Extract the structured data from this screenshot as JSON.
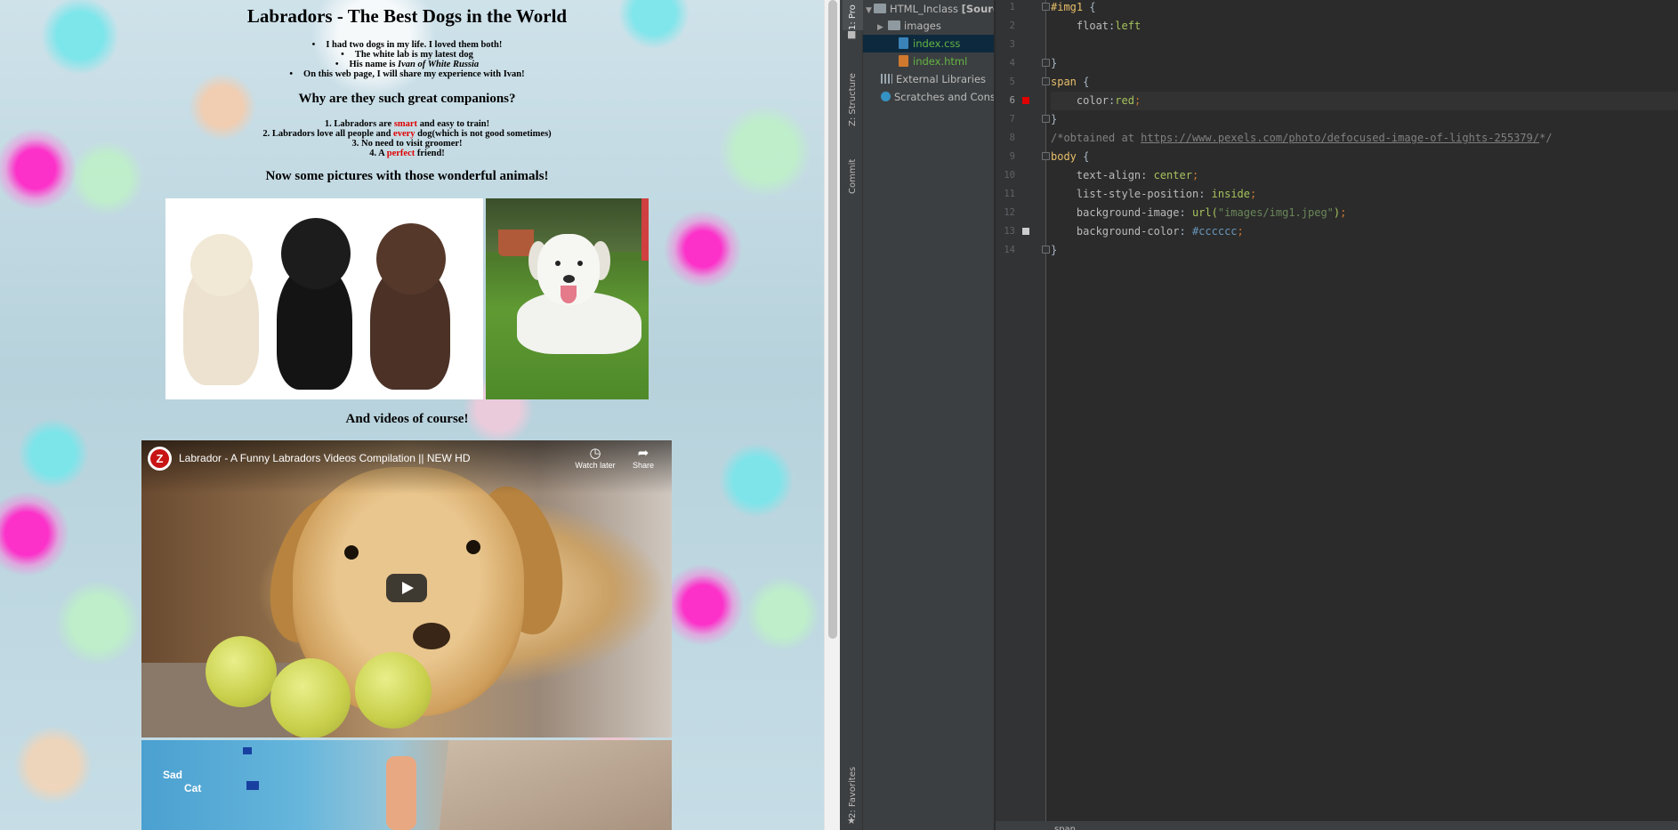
{
  "webpage": {
    "title": "Labradors - The Best Dogs in the World",
    "intro_list": [
      "I had two dogs in my life. I loved them both!",
      "The white lab is my latest dog",
      "His name is ",
      "On this web page, I will share my experience with Ivan!"
    ],
    "dog_name": "Ivan of White Russia",
    "h2_companions": "Why are they such great companions?",
    "reasons": {
      "r1_pre": "1. Labradors are ",
      "r1_red": "smart",
      "r1_post": " and easy to train!",
      "r2_pre": "2. Labradors love all people and ",
      "r2_red": "every",
      "r2_post": " dog(which is not good sometimes)",
      "r3": "3. No need to visit groomer!",
      "r4_pre": "4. A ",
      "r4_red": "perfect",
      "r4_post": " friend!"
    },
    "h2_pictures": "Now some pictures with those wonderful animals!",
    "h2_videos": "And videos of course!",
    "video1": {
      "channel_logo_letter": "Z",
      "title": "Labrador - A Funny Labradors Videos Compilation || NEW HD",
      "watch_later": "Watch later",
      "share": "Share"
    },
    "video2": {
      "overlay_line1": "Sad",
      "overlay_line2": "Cat"
    }
  },
  "ide": {
    "tool_tabs": {
      "project": "1: Pro",
      "structure": "Z: Structure",
      "commit": "Commit",
      "favorites": "2: Favorites"
    },
    "project_tree": [
      {
        "label": "HTML_Inclass",
        "tag": "[Sourc"
      },
      {
        "label": "images"
      },
      {
        "label": "index.css"
      },
      {
        "label": "index.html"
      },
      {
        "label": "External Libraries"
      },
      {
        "label": "Scratches and Conso"
      }
    ],
    "line_numbers": [
      "1",
      "2",
      "3",
      "4",
      "5",
      "6",
      "7",
      "8",
      "9",
      "10",
      "11",
      "12",
      "13",
      "14"
    ],
    "code": {
      "l1_sel": "#img1",
      "l1_brace": " {",
      "l2_prop": "float",
      "l2_val": "left",
      "l4": "}",
      "l5_sel": "span",
      "l5_brace": " {",
      "l6_prop": "color",
      "l6_val": "red",
      "l7": "}",
      "l8_pre": "/*obtained at ",
      "l8_url": "https://www.pexels.com/photo/defocused-image-of-lights-255379/",
      "l8_post": "*/",
      "l9_sel": "body",
      "l9_brace": " {",
      "l10_prop": "text-align",
      "l10_val": "center",
      "l11_prop": "list-style-position",
      "l11_val": "inside",
      "l12_prop": "background-image",
      "l12_fn": "url(",
      "l12_str": "\"images/img1.jpeg\"",
      "l12_close": ")",
      "l13_prop": "background-color",
      "l13_val": "#cccccc",
      "l14": "}"
    },
    "status_text": "span",
    "colors": {
      "red_marker": "#e00000",
      "gray_marker": "#cccccc"
    }
  }
}
